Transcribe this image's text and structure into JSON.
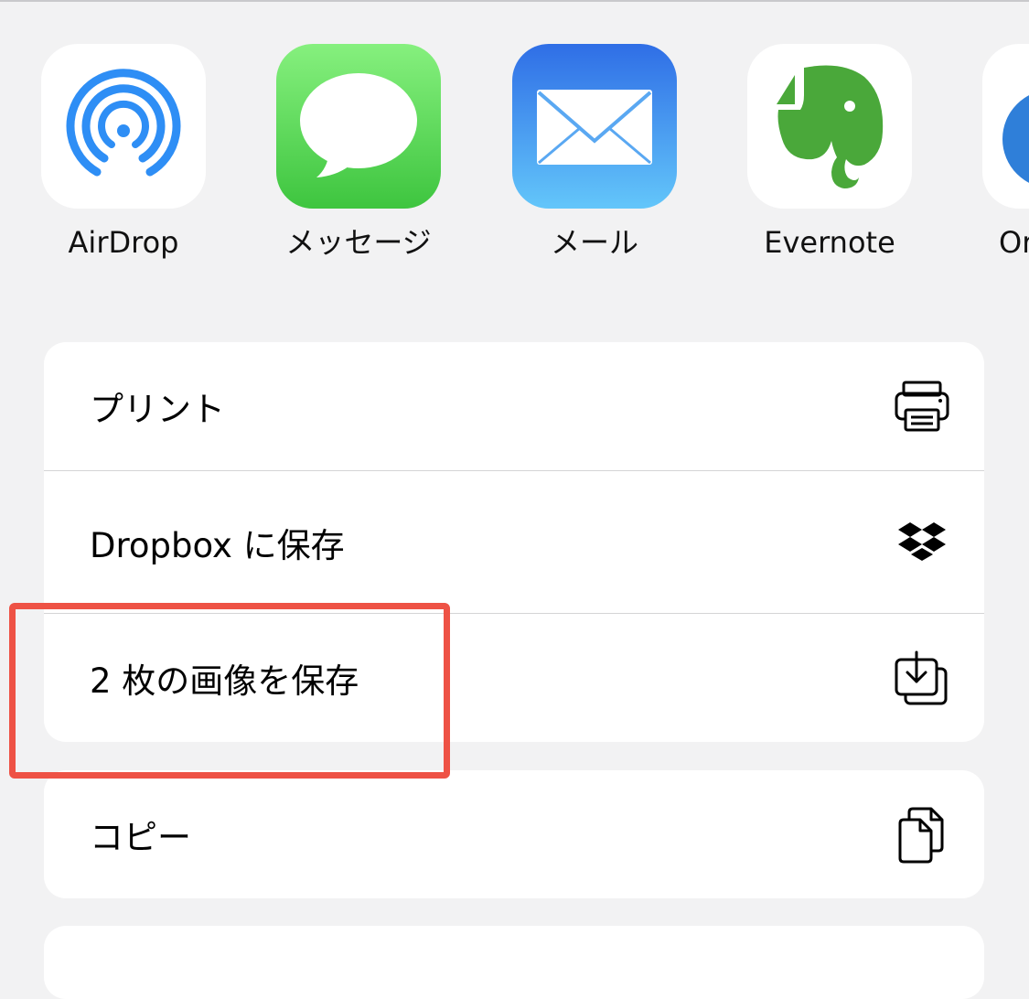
{
  "share_apps": [
    {
      "label": "AirDrop",
      "icon": "airdrop-icon"
    },
    {
      "label": "メッセージ",
      "icon": "messages-icon"
    },
    {
      "label": "メール",
      "icon": "mail-icon"
    },
    {
      "label": "Evernote",
      "icon": "evernote-icon"
    },
    {
      "label": "Or",
      "icon": "partial-app-icon"
    }
  ],
  "actions": [
    {
      "label": "プリント",
      "icon": "printer-icon"
    },
    {
      "label": "Dropbox に保存",
      "icon": "dropbox-icon"
    },
    {
      "label": "2 枚の画像を保存",
      "icon": "save-images-icon"
    }
  ],
  "actions_2": [
    {
      "label": "コピー",
      "icon": "copy-icon"
    }
  ],
  "colors": {
    "highlight": "#ee5245",
    "sheet_background": "#f2f2f3",
    "airdrop_blue": "#2e8ef5",
    "messages_green": "#5fd35f",
    "mail_blue": "#3a82ee",
    "evernote_green": "#4aa83a"
  }
}
